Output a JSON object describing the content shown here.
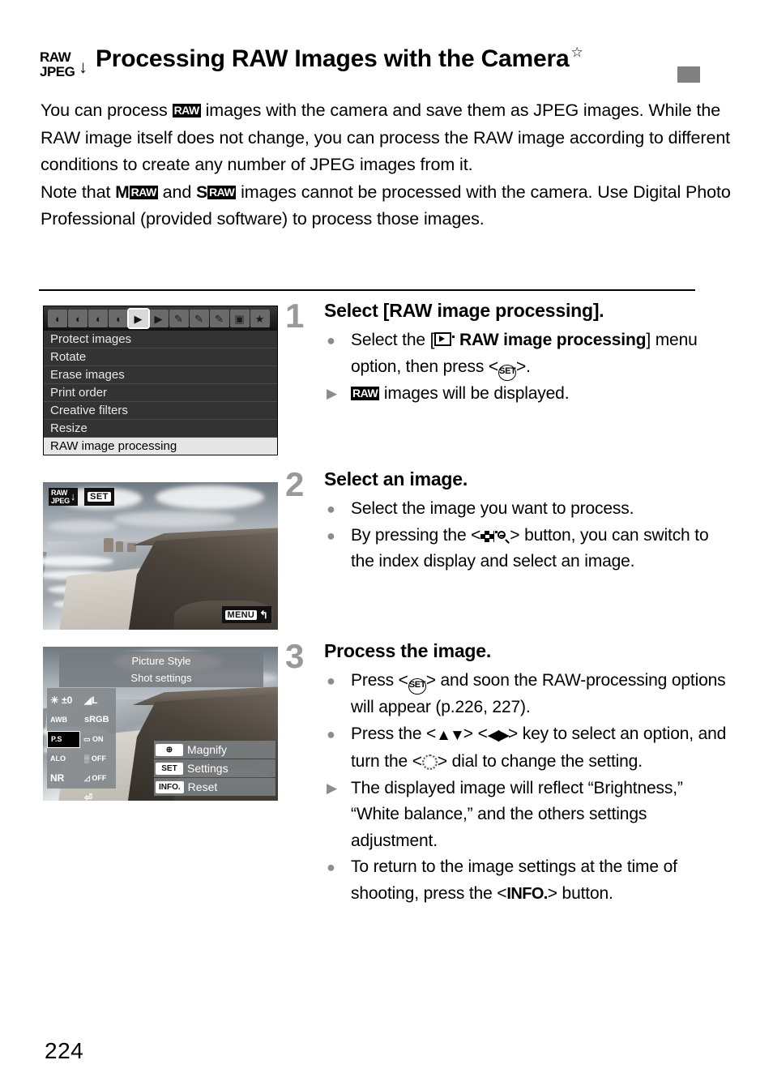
{
  "header": {
    "icon_line1": "RAW",
    "icon_line2": "JPEG",
    "icon_arrow": "↓",
    "title": "Processing RAW Images with the Camera",
    "star": "☆",
    "tab_marker_color": "#808080"
  },
  "intro": {
    "p1_a": "You can process ",
    "p1_raw": "RAW",
    "p1_b": " images with the camera and save them as JPEG images. While the RAW image itself does not change, you can process the RAW image according to different conditions to create any number of JPEG images from it.",
    "p2_a": "Note that ",
    "p2_m": "M",
    "p2_raw1": "RAW",
    "p2_and": " and ",
    "p2_s": "S",
    "p2_raw2": "RAW",
    "p2_b": " images cannot be processed with the camera. Use Digital Photo Professional (provided software) to process those images."
  },
  "figures": {
    "menu": {
      "tabs": [
        {
          "name": "shooting-1",
          "glyph": "◘"
        },
        {
          "name": "shooting-2",
          "glyph": "◘"
        },
        {
          "name": "shooting-3",
          "glyph": "◘"
        },
        {
          "name": "shooting-4",
          "glyph": "◘"
        },
        {
          "name": "playback-1",
          "glyph": "▶"
        },
        {
          "name": "playback-2",
          "glyph": "▶"
        },
        {
          "name": "setup-1",
          "glyph": "🔧"
        },
        {
          "name": "setup-2",
          "glyph": "🔧"
        },
        {
          "name": "setup-3",
          "glyph": "🔧"
        },
        {
          "name": "custom-functions",
          "glyph": "◉"
        },
        {
          "name": "my-menu",
          "glyph": "★"
        }
      ],
      "selected_tab_index": 4,
      "items": [
        "Protect images",
        "Rotate",
        "Erase images",
        "Print order",
        "Creative filters",
        "Resize",
        "RAW image processing"
      ],
      "selected_item_index": 6
    },
    "photo": {
      "badge_raw": "RAW",
      "badge_jpeg": "JPEG",
      "badge_arrow": "↓",
      "badge_set": "SET",
      "badge_menu": "MENU",
      "badge_menu_return": "↰"
    },
    "options": {
      "title_line1": "Picture Style",
      "title_line2": "Shot settings",
      "settings": [
        {
          "left": "☀ ±0",
          "right": "◢L"
        },
        {
          "left": "AWB",
          "right": "sRGB"
        },
        {
          "left": "P.S",
          "right": "▭ ON"
        },
        {
          "left": "ALO",
          "right": "▒ OFF"
        },
        {
          "left": "NR",
          "right": "◿ OFF"
        },
        {
          "left": "",
          "right": "⏎"
        }
      ],
      "highlighted_row_index": 2,
      "actions": [
        {
          "key": "magnify-icon",
          "label": "Magnify"
        },
        {
          "key": "SET",
          "label": "Settings"
        },
        {
          "key": "INFO.",
          "label": "Reset"
        }
      ]
    }
  },
  "steps": [
    {
      "number": "1",
      "heading": "Select [RAW image processing].",
      "lines": [
        {
          "marker": "dot",
          "text_parts": [
            "Select the [",
            "playback-icon",
            " ",
            "RAW image processing",
            "] menu option, then press <",
            "SET",
            ">."
          ]
        },
        {
          "marker": "triangle",
          "text_parts": [
            "",
            "RAW",
            " images will be displayed."
          ]
        }
      ]
    },
    {
      "number": "2",
      "heading": "Select an image.",
      "lines": [
        {
          "marker": "dot",
          "text": "Select the image you want to process."
        },
        {
          "marker": "dot",
          "text_parts": [
            "By pressing the <",
            "index-magnify-icon",
            "> button, you can switch to the index display and select an image."
          ]
        }
      ]
    },
    {
      "number": "3",
      "heading": "Process the image.",
      "lines": [
        {
          "marker": "dot",
          "text_parts": [
            "Press <",
            "SET",
            "> and soon the RAW-processing options will appear (p.226, 227)."
          ]
        },
        {
          "marker": "dot",
          "text_parts": [
            "Press the <",
            "updown",
            "> <",
            "leftright",
            "> key to select an option, and turn the <",
            "dial",
            "> dial to change the setting."
          ]
        },
        {
          "marker": "triangle",
          "text": "The displayed image will reflect “Brightness,” “White balance,” and the others settings adjustment."
        },
        {
          "marker": "dot",
          "text_parts": [
            "To return to the image settings at the time of shooting, press the <",
            "INFO.",
            "> button."
          ]
        }
      ]
    }
  ],
  "page_number": "224"
}
